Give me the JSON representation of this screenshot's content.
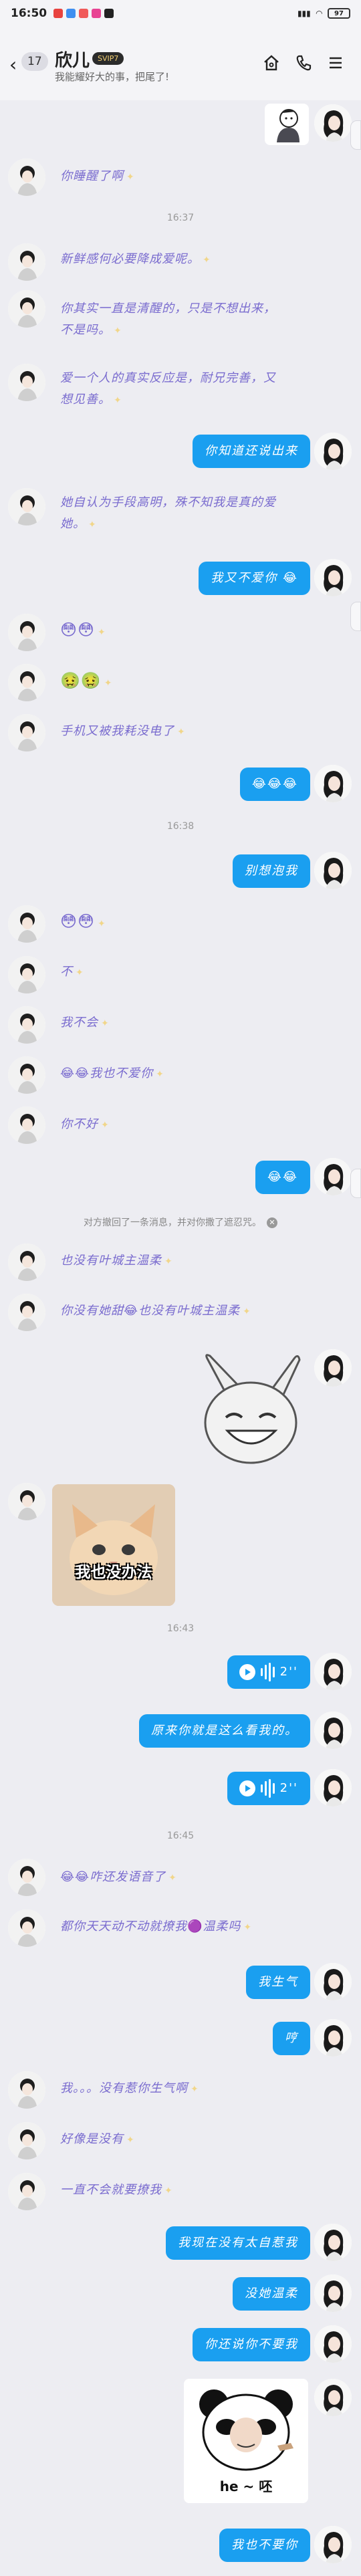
{
  "status_bar": {
    "time": "16:50",
    "battery": "97"
  },
  "header": {
    "unread_count": "17",
    "contact_name": "欣儿",
    "vip_badge": "SVIP7",
    "signature": "我能耀好大的事，把尾了!"
  },
  "timestamps": [
    "16:37",
    "16:38",
    "16:43",
    "16:45"
  ],
  "recall_notice": "对方撤回了一条消息，并对你撒了遮忍咒。",
  "messages": {
    "m1": "你睡醒了啊",
    "m2": "新鲜感何必要降成爱呢。",
    "m3": "你其实一直是清醒的，只是不想出来，不是吗。",
    "m4": "爱一个人的真实反应是，耐兄完善，又想见善。",
    "m5": "你知道还说出来",
    "m6": "她自认为手段高明，殊不知我是真的爱她。",
    "m7": "我又不爱你",
    "m8": "手机又被我耗没电了",
    "m9": "别想泡我",
    "m10": "不",
    "m11": "我不会",
    "m12": "我也不爱你",
    "m13": "你不好",
    "m14": "也没有叶城主温柔",
    "m15": "你没有她甜",
    "m15b": "也没有叶城主温柔",
    "cat_caption": "我也没办法",
    "voice1": "2''",
    "m16": "原来你就是这么看我的。",
    "voice2": "2''",
    "m17": "咋还发语音了",
    "m18": "都你天天动不动就撩我",
    "m18b": "温柔吗",
    "m19": "我生气",
    "m20": "哼",
    "m21": "我。。。没有惹你生气啊",
    "m22": "好像是没有",
    "m23": "一直不会就要撩我",
    "m24": "我现在没有太自惹我",
    "m25": "没她温柔",
    "m26": "你还说你不要我",
    "panda_caption": "he ~ 呸",
    "m27": "我也不要你"
  }
}
